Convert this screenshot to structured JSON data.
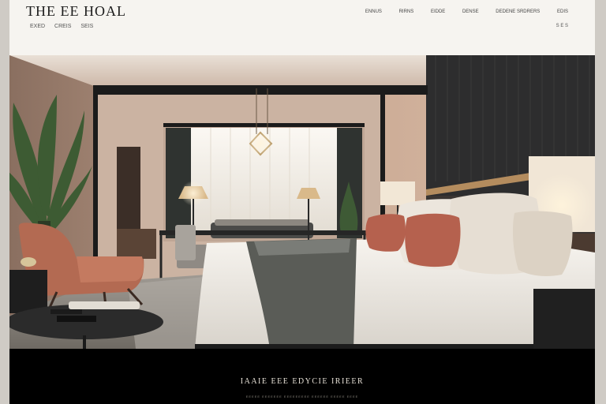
{
  "brand": {
    "logo": "THE EE HOAL"
  },
  "header": {
    "subnav": [
      "EXED",
      "CREIS",
      "SEIS"
    ],
    "nav": [
      "ENNUS",
      "RIRNS",
      "EIDDE",
      "DENSE",
      "DEDENE SRDRERS",
      "EDIS"
    ],
    "nav_small": "S E S"
  },
  "hero": {
    "scene": "luxury-hotel-bedroom",
    "colors": {
      "wall_dark": "#2d2d2e",
      "wall_warm": "#b79b89",
      "bed_white": "#f4f1ec",
      "pillow_rust": "#b5614e",
      "lamp_shade": "#f1e6d6",
      "chair": "#b36a52"
    }
  },
  "footer": {
    "title": "IAAIE  EEE  EDYCIE  IRIEER",
    "subtitle": "EEEEE  EEEEEEE  EEEEEEEEE  EEEEEE  EEEEE  EEEE"
  }
}
